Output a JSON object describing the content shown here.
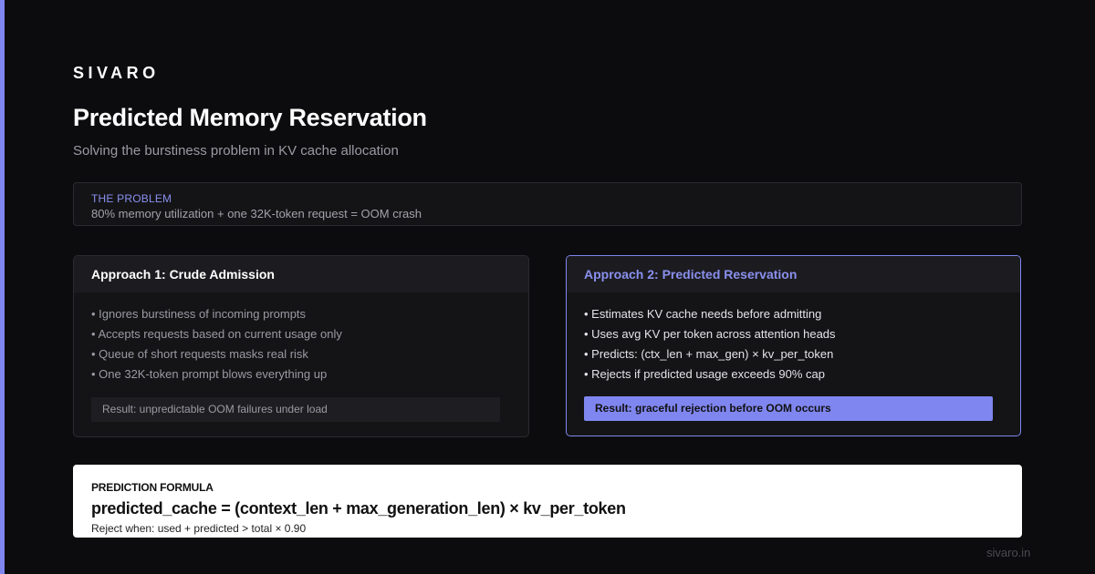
{
  "brand": "SIVARO",
  "title": "Predicted Memory Reservation",
  "subtitle": "Solving the burstiness problem in KV cache allocation",
  "problem": {
    "label": "THE PROBLEM",
    "text": "80% memory utilization + one 32K-token request = OOM crash"
  },
  "approach1": {
    "title": "Approach 1: Crude Admission",
    "bullets": [
      "• Ignores burstiness of incoming prompts",
      "• Accepts requests based on current usage only",
      "• Queue of short requests masks real risk",
      "• One 32K-token prompt blows everything up"
    ],
    "result": "Result: unpredictable OOM failures under load"
  },
  "approach2": {
    "title": "Approach 2: Predicted Reservation",
    "bullets": [
      "• Estimates KV cache needs before admitting",
      "• Uses avg KV per token across attention heads",
      "• Predicts: (ctx_len + max_gen) × kv_per_token",
      "• Rejects if predicted usage exceeds 90% cap"
    ],
    "result": "Result: graceful rejection before OOM occurs"
  },
  "formula": {
    "label": "PREDICTION FORMULA",
    "text": "predicted_cache = (context_len + max_generation_len) × kv_per_token",
    "note": "Reject when: used + predicted > total × 0.90"
  },
  "footer_url": "sivaro.in",
  "colors": {
    "accent": "#7f86f0",
    "background": "#0c0c0e",
    "card": "#141416"
  }
}
